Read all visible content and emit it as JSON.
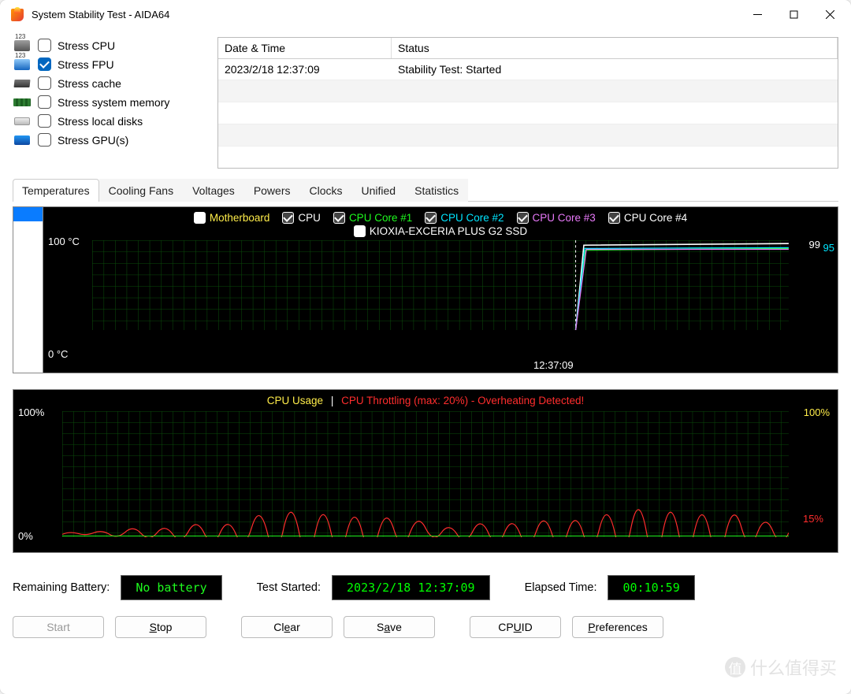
{
  "window": {
    "title": "System Stability Test - AIDA64"
  },
  "stress": {
    "cpu": "Stress CPU",
    "fpu": "Stress FPU",
    "cache": "Stress cache",
    "mem": "Stress system memory",
    "disk": "Stress local disks",
    "gpu": "Stress GPU(s)",
    "checked": {
      "cpu": false,
      "fpu": true,
      "cache": false,
      "mem": false,
      "disk": false,
      "gpu": false
    }
  },
  "log": {
    "headers": {
      "datetime": "Date & Time",
      "status": "Status"
    },
    "rows": [
      {
        "datetime": "2023/2/18 12:37:09",
        "status": "Stability Test: Started"
      }
    ]
  },
  "tabs": [
    "Temperatures",
    "Cooling Fans",
    "Voltages",
    "Powers",
    "Clocks",
    "Unified",
    "Statistics"
  ],
  "tempchart": {
    "series": {
      "motherboard": {
        "label": "Motherboard",
        "color": "#ffed4a",
        "checked": false
      },
      "cpu": {
        "label": "CPU",
        "color": "#ffffff",
        "checked": true
      },
      "core1": {
        "label": "CPU Core #1",
        "color": "#1efb1e",
        "checked": true
      },
      "core2": {
        "label": "CPU Core #2",
        "color": "#00e5ff",
        "checked": true
      },
      "core3": {
        "label": "CPU Core #3",
        "color": "#e879f9",
        "checked": true
      },
      "core4": {
        "label": "CPU Core #4",
        "color": "#ffffff",
        "checked": true
      },
      "ssd": {
        "label": "KIOXIA-EXCERIA PLUS G2 SSD",
        "color": "#ffffff",
        "checked": false
      }
    },
    "ylabels": {
      "top": "100 °C",
      "bottom": "0 °C"
    },
    "xmarker": "12:37:09",
    "readouts": {
      "a": "99",
      "b": "95"
    }
  },
  "cpuchart": {
    "usage_label": "CPU Usage",
    "warning": "CPU Throttling (max: 20%) - Overheating Detected!",
    "ylabels": {
      "top": "100%",
      "bottom": "0%"
    },
    "right": {
      "top": "100%",
      "throttle": "15%"
    }
  },
  "status": {
    "battery_label": "Remaining Battery:",
    "battery_value": "No battery",
    "started_label": "Test Started:",
    "started_value": "2023/2/18 12:37:09",
    "elapsed_label": "Elapsed Time:",
    "elapsed_value": "00:10:59"
  },
  "buttons": {
    "start": "Start",
    "stop": "Stop",
    "clear": "Clear",
    "save": "Save",
    "cpuid": "CPUID",
    "prefs": "Preferences"
  },
  "chart_data": [
    {
      "type": "line",
      "title": "Temperatures",
      "ylabel": "°C",
      "ylim": [
        0,
        100
      ],
      "x_event": "12:37:09",
      "series": [
        {
          "name": "CPU",
          "value_after_event": 99
        },
        {
          "name": "CPU Core #1",
          "value_after_event": 95
        },
        {
          "name": "CPU Core #2",
          "value_after_event": 95
        },
        {
          "name": "CPU Core #3",
          "value_after_event": 95
        },
        {
          "name": "CPU Core #4",
          "value_after_event": 95
        }
      ],
      "note": "values flat near 0 before event, step up sharply at x_event"
    },
    {
      "type": "line",
      "title": "CPU Usage / Throttling",
      "ylabel": "%",
      "ylim": [
        0,
        100
      ],
      "series": [
        {
          "name": "CPU Usage",
          "approx_constant": 3
        },
        {
          "name": "CPU Throttling",
          "approx_mean": 15,
          "max": 20
        }
      ]
    }
  ],
  "watermark": "什么值得买"
}
